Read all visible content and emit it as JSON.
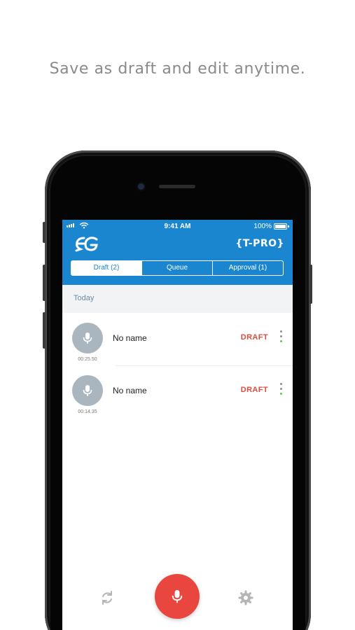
{
  "headline": "Save as draft and edit anytime.",
  "status_bar": {
    "time": "9:41 AM",
    "battery": "100%"
  },
  "app": {
    "brand_right": "{T-PRO}"
  },
  "tabs": [
    {
      "label": "Draft (2)",
      "active": true
    },
    {
      "label": "Queue",
      "active": false
    },
    {
      "label": "Approval (1)",
      "active": false
    }
  ],
  "section": {
    "label": "Today"
  },
  "recordings": [
    {
      "title": "No name",
      "duration": "00:25.50",
      "status": "DRAFT"
    },
    {
      "title": "No name",
      "duration": "00:14.35",
      "status": "DRAFT"
    }
  ],
  "colors": {
    "app_bar": "#1a86d0",
    "draft_status": "#e04b3f",
    "record_button": "#e9463f",
    "avatar": "#aab6bf"
  },
  "icons": [
    "mic-icon",
    "more-vertical-icon",
    "refresh-icon",
    "settings-icon",
    "wifi-icon",
    "battery-icon",
    "signal-icon"
  ]
}
